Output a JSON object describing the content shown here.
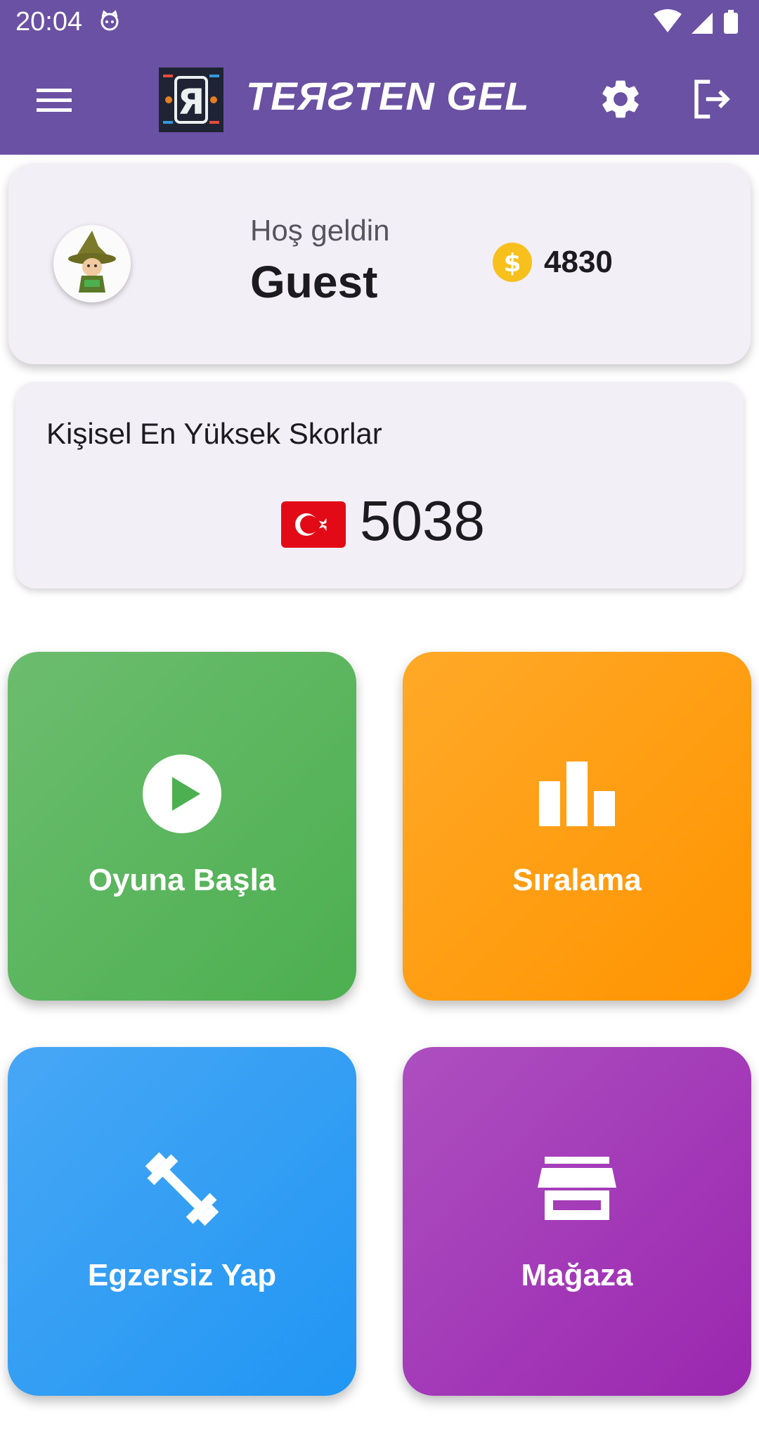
{
  "status_bar": {
    "time": "20:04"
  },
  "app_bar": {
    "title": "TERSTEN GEL",
    "title_display": "TEЯƧTEN GEL",
    "logo_letter": "Я",
    "background_color": "#6a51a3"
  },
  "welcome": {
    "greeting": "Hoş geldin",
    "username": "Guest",
    "coin_count": "4830",
    "coin_symbol": "$"
  },
  "scores": {
    "heading": "Kişisel En Yüksek Skorlar",
    "value": "5038",
    "flag": "turkey-flag"
  },
  "tiles": [
    {
      "label": "Oyuna Başla",
      "icon": "play-icon",
      "color": "#4caf50"
    },
    {
      "label": "Sıralama",
      "icon": "bar-chart-icon",
      "color": "#ff9800"
    },
    {
      "label": "Egzersiz Yap",
      "icon": "fitness-icon",
      "color": "#2196f3"
    },
    {
      "label": "Mağaza",
      "icon": "store-icon",
      "color": "#9c27b0"
    }
  ]
}
